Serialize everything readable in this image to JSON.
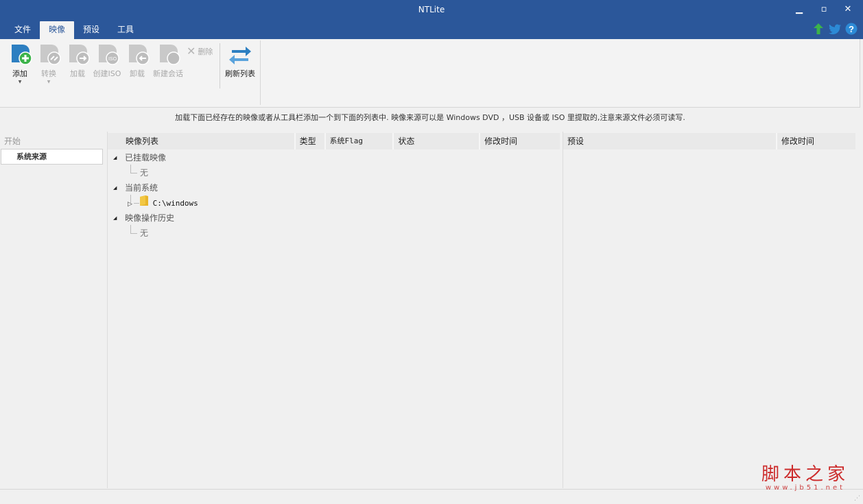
{
  "window": {
    "title": "NTLite",
    "minimize_icon": "minimize-icon",
    "maximize_icon": "maximize-icon",
    "close_icon": "close-icon"
  },
  "tabs": [
    {
      "label": "文件",
      "active": false
    },
    {
      "label": "映像",
      "active": true
    },
    {
      "label": "预设",
      "active": false
    },
    {
      "label": "工具",
      "active": false
    }
  ],
  "top_icons": [
    "update-arrow-icon",
    "twitter-icon",
    "help-icon"
  ],
  "ribbon": {
    "add": "添加",
    "convert": "转换",
    "load": "加载",
    "create_iso": "创建ISO",
    "unload": "卸载",
    "new_session": "新建会话",
    "delete": "删除",
    "refresh": "刷新列表"
  },
  "info_text": "加载下面已经存在的映像或者从工具栏添加一个到下面的列表中. 映像来源可以是 Windows DVD ，USB 设备或 ISO 里提取的,注意来源文件必须可读写.",
  "nav": {
    "start": "开始",
    "source": "系统来源"
  },
  "image_list": {
    "columns": [
      "映像列表",
      "类型",
      "系统Flag",
      "状态",
      "修改时间"
    ],
    "groups": [
      {
        "label": "已挂载映像",
        "children": [
          "无"
        ]
      },
      {
        "label": "当前系统",
        "children": [
          "C:\\windows"
        ]
      },
      {
        "label": "映像操作历史",
        "children": [
          "无"
        ]
      }
    ]
  },
  "presets": {
    "columns": [
      "预设",
      "修改时间"
    ]
  },
  "watermark": {
    "logo": "脚本之家",
    "url": "www.jb51.net"
  },
  "colors": {
    "titlebar": "#2b579a",
    "ribbon": "#f3f3f3",
    "accent_green": "#3cb34a",
    "accent_blue": "#2c8ad6"
  }
}
